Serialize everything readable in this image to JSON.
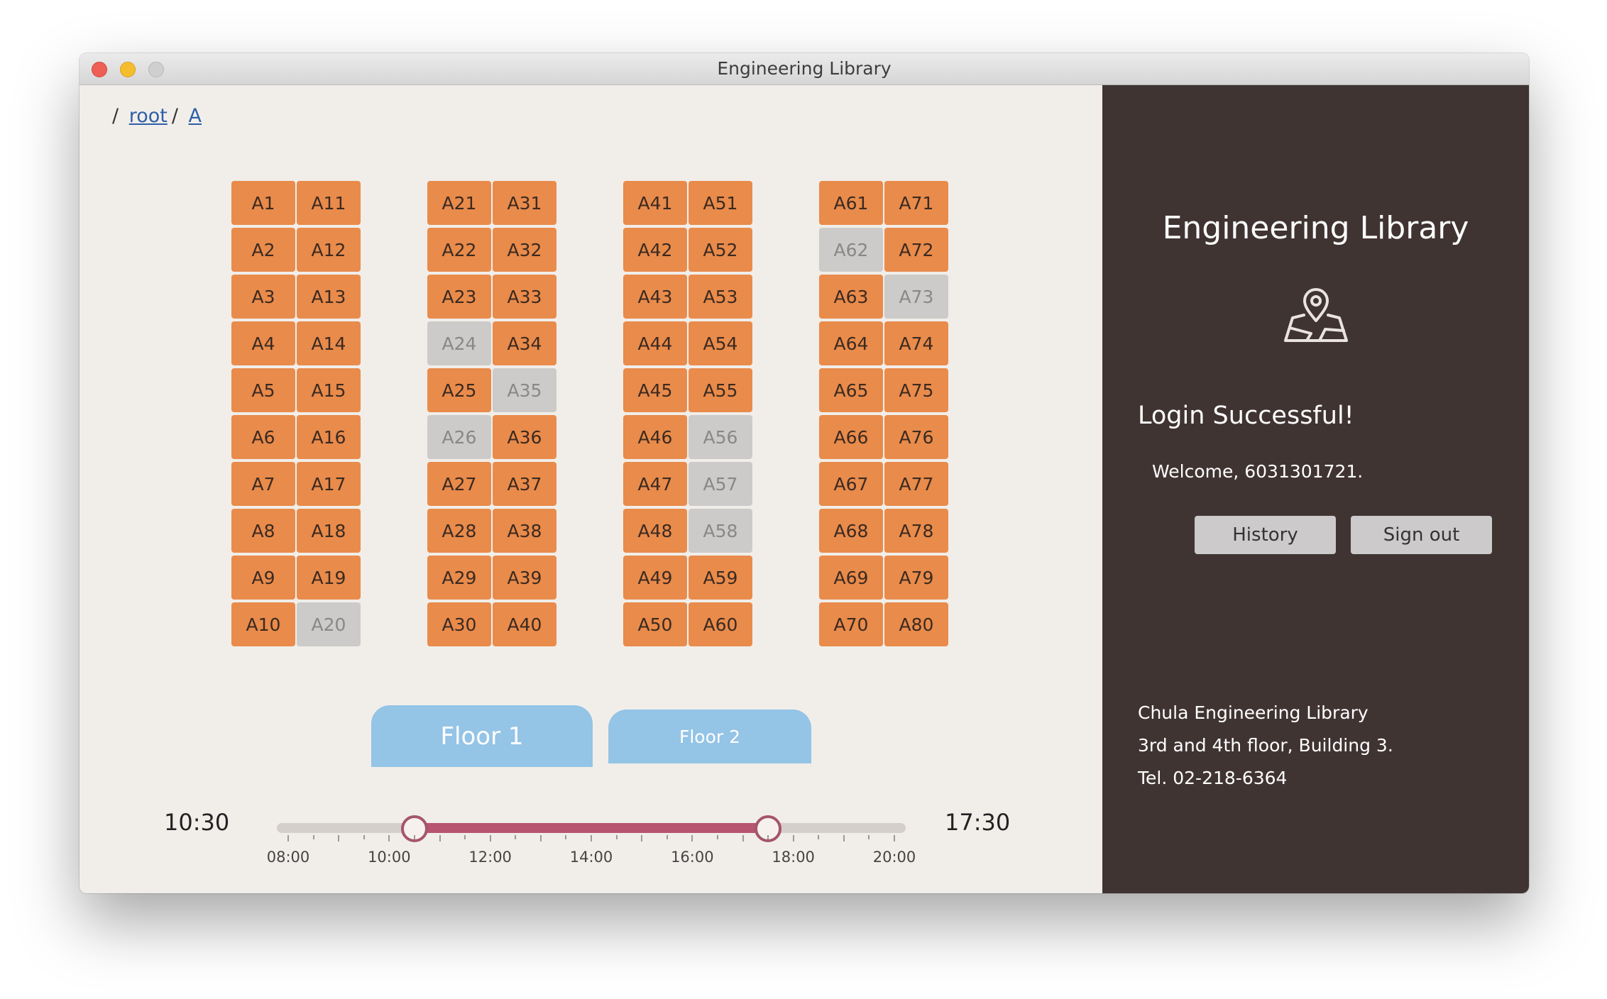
{
  "window": {
    "title": "Engineering Library"
  },
  "breadcrumb": {
    "prefix": "/",
    "items": [
      "root",
      "A"
    ],
    "separator": "/"
  },
  "seat_blocks": [
    {
      "columns": [
        [
          {
            "id": "A1",
            "available": true
          },
          {
            "id": "A2",
            "available": true
          },
          {
            "id": "A3",
            "available": true
          },
          {
            "id": "A4",
            "available": true
          },
          {
            "id": "A5",
            "available": true
          },
          {
            "id": "A6",
            "available": true
          },
          {
            "id": "A7",
            "available": true
          },
          {
            "id": "A8",
            "available": true
          },
          {
            "id": "A9",
            "available": true
          },
          {
            "id": "A10",
            "available": true
          }
        ],
        [
          {
            "id": "A11",
            "available": true
          },
          {
            "id": "A12",
            "available": true
          },
          {
            "id": "A13",
            "available": true
          },
          {
            "id": "A14",
            "available": true
          },
          {
            "id": "A15",
            "available": true
          },
          {
            "id": "A16",
            "available": true
          },
          {
            "id": "A17",
            "available": true
          },
          {
            "id": "A18",
            "available": true
          },
          {
            "id": "A19",
            "available": true
          },
          {
            "id": "A20",
            "available": false
          }
        ]
      ]
    },
    {
      "columns": [
        [
          {
            "id": "A21",
            "available": true
          },
          {
            "id": "A22",
            "available": true
          },
          {
            "id": "A23",
            "available": true
          },
          {
            "id": "A24",
            "available": false
          },
          {
            "id": "A25",
            "available": true
          },
          {
            "id": "A26",
            "available": false
          },
          {
            "id": "A27",
            "available": true
          },
          {
            "id": "A28",
            "available": true
          },
          {
            "id": "A29",
            "available": true
          },
          {
            "id": "A30",
            "available": true
          }
        ],
        [
          {
            "id": "A31",
            "available": true
          },
          {
            "id": "A32",
            "available": true
          },
          {
            "id": "A33",
            "available": true
          },
          {
            "id": "A34",
            "available": true
          },
          {
            "id": "A35",
            "available": false
          },
          {
            "id": "A36",
            "available": true
          },
          {
            "id": "A37",
            "available": true
          },
          {
            "id": "A38",
            "available": true
          },
          {
            "id": "A39",
            "available": true
          },
          {
            "id": "A40",
            "available": true
          }
        ]
      ]
    },
    {
      "columns": [
        [
          {
            "id": "A41",
            "available": true
          },
          {
            "id": "A42",
            "available": true
          },
          {
            "id": "A43",
            "available": true
          },
          {
            "id": "A44",
            "available": true
          },
          {
            "id": "A45",
            "available": true
          },
          {
            "id": "A46",
            "available": true
          },
          {
            "id": "A47",
            "available": true
          },
          {
            "id": "A48",
            "available": true
          },
          {
            "id": "A49",
            "available": true
          },
          {
            "id": "A50",
            "available": true
          }
        ],
        [
          {
            "id": "A51",
            "available": true
          },
          {
            "id": "A52",
            "available": true
          },
          {
            "id": "A53",
            "available": true
          },
          {
            "id": "A54",
            "available": true
          },
          {
            "id": "A55",
            "available": true
          },
          {
            "id": "A56",
            "available": false
          },
          {
            "id": "A57",
            "available": false
          },
          {
            "id": "A58",
            "available": false
          },
          {
            "id": "A59",
            "available": true
          },
          {
            "id": "A60",
            "available": true
          }
        ]
      ]
    },
    {
      "columns": [
        [
          {
            "id": "A61",
            "available": true
          },
          {
            "id": "A62",
            "available": false
          },
          {
            "id": "A63",
            "available": true
          },
          {
            "id": "A64",
            "available": true
          },
          {
            "id": "A65",
            "available": true
          },
          {
            "id": "A66",
            "available": true
          },
          {
            "id": "A67",
            "available": true
          },
          {
            "id": "A68",
            "available": true
          },
          {
            "id": "A69",
            "available": true
          },
          {
            "id": "A70",
            "available": true
          }
        ],
        [
          {
            "id": "A71",
            "available": true
          },
          {
            "id": "A72",
            "available": true
          },
          {
            "id": "A73",
            "available": false
          },
          {
            "id": "A74",
            "available": true
          },
          {
            "id": "A75",
            "available": true
          },
          {
            "id": "A76",
            "available": true
          },
          {
            "id": "A77",
            "available": true
          },
          {
            "id": "A78",
            "available": true
          },
          {
            "id": "A79",
            "available": true
          },
          {
            "id": "A80",
            "available": true
          }
        ]
      ]
    }
  ],
  "floors": {
    "floor1": "Floor 1",
    "floor2": "Floor 2",
    "selected": "Floor 1"
  },
  "time_range": {
    "start_label": "10:30",
    "end_label": "17:30",
    "min_hours": 8,
    "max_hours": 20,
    "start_hours": 10.5,
    "end_hours": 17.5,
    "tick_labels": [
      "08:00",
      "10:00",
      "12:00",
      "14:00",
      "16:00",
      "18:00",
      "20:00"
    ]
  },
  "sidebar": {
    "title": "Engineering Library",
    "icon": "map-pin-icon",
    "login_status": "Login Successful!",
    "welcome": "Welcome, 6031301721.",
    "history_label": "History",
    "signout_label": "Sign out",
    "info": {
      "name": "Chula Engineering Library",
      "location": "3rd and 4th floor, Building 3.",
      "tel": "Tel. 02-218-6364"
    }
  },
  "colors": {
    "seat_available": "#e98b4b",
    "seat_unavailable": "#cdcbc9",
    "floor_tab": "#94c4e6",
    "slider_fill": "#b75470",
    "sidebar_bg": "#403433"
  }
}
